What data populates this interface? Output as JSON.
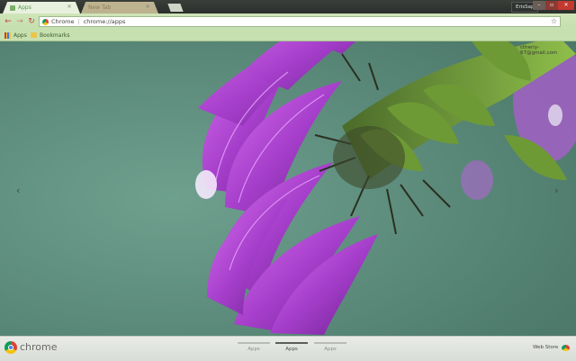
{
  "tabs": [
    {
      "label": "Apps",
      "active": true
    },
    {
      "label": "New Tab",
      "active": false
    }
  ],
  "window": {
    "profile": "ErisSap",
    "minimize_icon": "minimize-icon",
    "maximize_icon": "maximize-icon",
    "close_icon": "close-icon"
  },
  "omnibox": {
    "chip": "Chrome",
    "separator": "|",
    "url": "chrome://apps"
  },
  "bookmarks": [
    {
      "label": "Apps"
    },
    {
      "label": "Bookmarks"
    }
  ],
  "account": {
    "email": "ctheriy-67@gmail.com"
  },
  "bottom": {
    "brand": "chrome",
    "pages": [
      {
        "label": "Apps",
        "active": false
      },
      {
        "label": "Apps",
        "active": true
      },
      {
        "label": "Apps",
        "active": false
      }
    ],
    "webstore": "Web Store"
  },
  "colors": {
    "accent": "#c0443a",
    "toolbar": "#cfe5b9",
    "petal": "#a84fd0"
  }
}
